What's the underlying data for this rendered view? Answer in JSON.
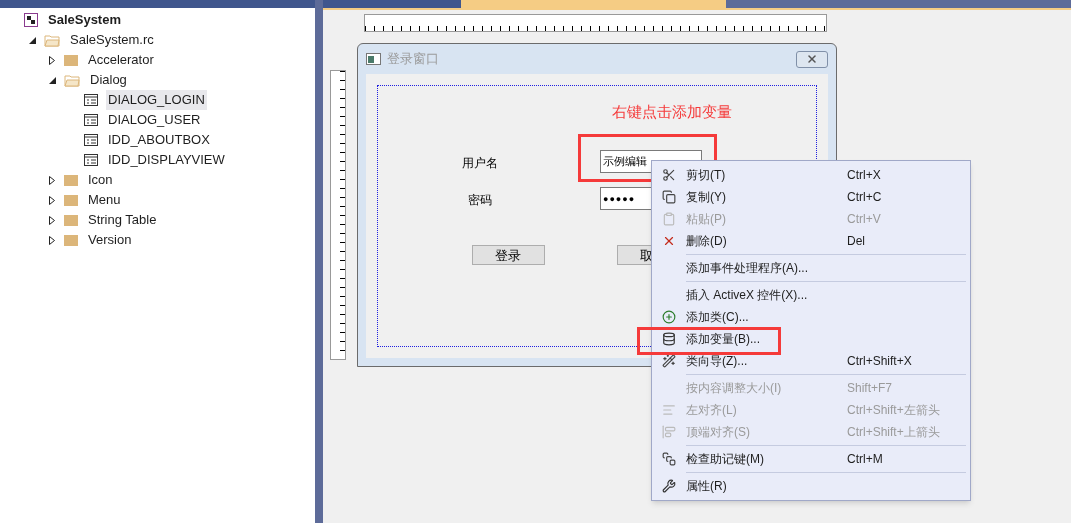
{
  "tree": [
    {
      "label": "SaleSystem",
      "kind": "project",
      "selected": false,
      "children": [
        {
          "label": "SaleSystem.rc",
          "kind": "folder",
          "expanded": true,
          "selected": false,
          "children": [
            {
              "label": "Accelerator",
              "kind": "folder",
              "expanded": false,
              "selected": false
            },
            {
              "label": "Dialog",
              "kind": "folder",
              "expanded": true,
              "selected": false,
              "children": [
                {
                  "label": "DIALOG_LOGIN",
                  "kind": "dialog",
                  "selected": true
                },
                {
                  "label": "DIALOG_USER",
                  "kind": "dialog",
                  "selected": false
                },
                {
                  "label": "IDD_ABOUTBOX",
                  "kind": "dialog",
                  "selected": false
                },
                {
                  "label": "IDD_DISPLAYVIEW",
                  "kind": "dialog",
                  "selected": false
                }
              ]
            },
            {
              "label": "Icon",
              "kind": "folder",
              "expanded": false,
              "selected": false
            },
            {
              "label": "Menu",
              "kind": "folder",
              "expanded": false,
              "selected": false
            },
            {
              "label": "String Table",
              "kind": "folder",
              "expanded": false,
              "selected": false
            },
            {
              "label": "Version",
              "kind": "folder",
              "expanded": false,
              "selected": false
            }
          ]
        }
      ]
    }
  ],
  "dialog": {
    "title": "登录窗口",
    "annotation": "右键点击添加变量",
    "fields": [
      {
        "label": "用户名",
        "kind": "text",
        "value": "示例编辑"
      },
      {
        "label": "密码",
        "kind": "password",
        "value": "●●●●●"
      }
    ],
    "buttons": [
      "登录",
      "取"
    ]
  },
  "context_menu": [
    {
      "kind": "item",
      "label": "剪切(T)",
      "shortcut": "Ctrl+X",
      "disabled": false
    },
    {
      "kind": "item",
      "label": "复制(Y)",
      "shortcut": "Ctrl+C",
      "disabled": false
    },
    {
      "kind": "item",
      "label": "粘贴(P)",
      "shortcut": "Ctrl+V",
      "disabled": true
    },
    {
      "kind": "item",
      "label": "删除(D)",
      "shortcut": "Del",
      "disabled": false
    },
    {
      "kind": "separator"
    },
    {
      "kind": "item",
      "label": "添加事件处理程序(A)...",
      "disabled": false
    },
    {
      "kind": "separator"
    },
    {
      "kind": "item",
      "label": "插入 ActiveX 控件(X)...",
      "disabled": false
    },
    {
      "kind": "item",
      "label": "添加类(C)...",
      "disabled": false
    },
    {
      "kind": "item",
      "label": "添加变量(B)...",
      "disabled": false
    },
    {
      "kind": "item",
      "label": "类向导(Z)...",
      "shortcut": "Ctrl+Shift+X",
      "disabled": false
    },
    {
      "kind": "separator"
    },
    {
      "kind": "item",
      "label": "按内容调整大小(I)",
      "shortcut": "Shift+F7",
      "disabled": true
    },
    {
      "kind": "item",
      "label": "左对齐(L)",
      "shortcut": "Ctrl+Shift+左箭头",
      "disabled": true
    },
    {
      "kind": "item",
      "label": "顶端对齐(S)",
      "shortcut": "Ctrl+Shift+上箭头",
      "disabled": true
    },
    {
      "kind": "separator"
    },
    {
      "kind": "item",
      "label": "检查助记键(M)",
      "shortcut": "Ctrl+M",
      "disabled": false
    },
    {
      "kind": "separator"
    },
    {
      "kind": "item",
      "label": "属性(R)",
      "disabled": false
    }
  ]
}
